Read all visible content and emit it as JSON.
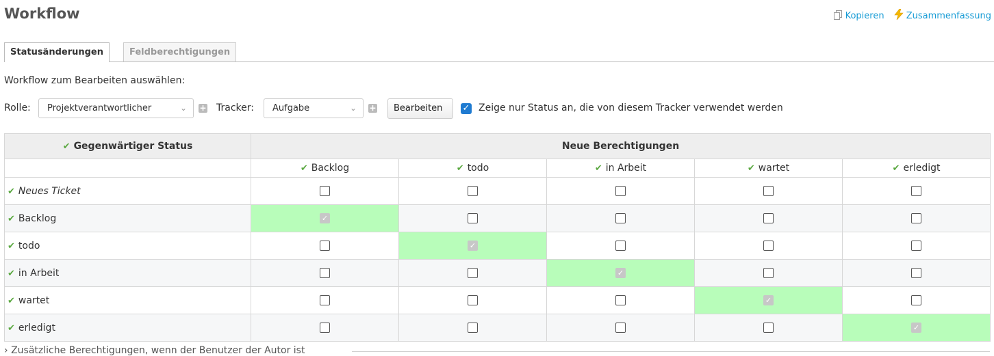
{
  "header": {
    "title": "Workflow",
    "actions": {
      "copy": {
        "label": "Kopieren",
        "icon": "copy-icon"
      },
      "summary": {
        "label": "Zusammenfassung",
        "icon": "lightning-icon"
      }
    }
  },
  "tabs": [
    {
      "label": "Statusänderungen",
      "selected": true
    },
    {
      "label": "Feldberechtigungen",
      "selected": false
    }
  ],
  "select_label": "Workflow zum Bearbeiten auswählen:",
  "filters": {
    "role_label": "Rolle:",
    "role_value": "Projektverantwortlicher",
    "tracker_label": "Tracker:",
    "tracker_value": "Aufgabe",
    "edit_button": "Bearbeiten",
    "only_used_statuses_checked": true,
    "only_used_statuses_label": "Zeige nur Status an, die von diesem Tracker verwendet werden"
  },
  "table": {
    "current_status_header": "Gegenwärtiger Status",
    "new_permissions_header": "Neue Berechtigungen",
    "columns": [
      "Backlog",
      "todo",
      "in Arbeit",
      "wartet",
      "erledigt"
    ],
    "rows": [
      {
        "label": "Neues Ticket",
        "italic": true,
        "cells": [
          false,
          false,
          false,
          false,
          false
        ]
      },
      {
        "label": "Backlog",
        "italic": false,
        "cells": [
          true,
          false,
          false,
          false,
          false
        ]
      },
      {
        "label": "todo",
        "italic": false,
        "cells": [
          false,
          true,
          false,
          false,
          false
        ]
      },
      {
        "label": "in Arbeit",
        "italic": false,
        "cells": [
          false,
          false,
          true,
          false,
          false
        ]
      },
      {
        "label": "wartet",
        "italic": false,
        "cells": [
          false,
          false,
          false,
          true,
          false
        ]
      },
      {
        "label": "erledigt",
        "italic": false,
        "cells": [
          false,
          false,
          false,
          false,
          true
        ]
      }
    ]
  },
  "collapsible": {
    "label": "Zusätzliche Berechtigungen, wenn der Benutzer der Autor ist"
  },
  "colors": {
    "link": "#169bd5",
    "check": "#5aa840",
    "highlight": "#b8fdba",
    "checkbox_accent": "#1f7bd1"
  }
}
